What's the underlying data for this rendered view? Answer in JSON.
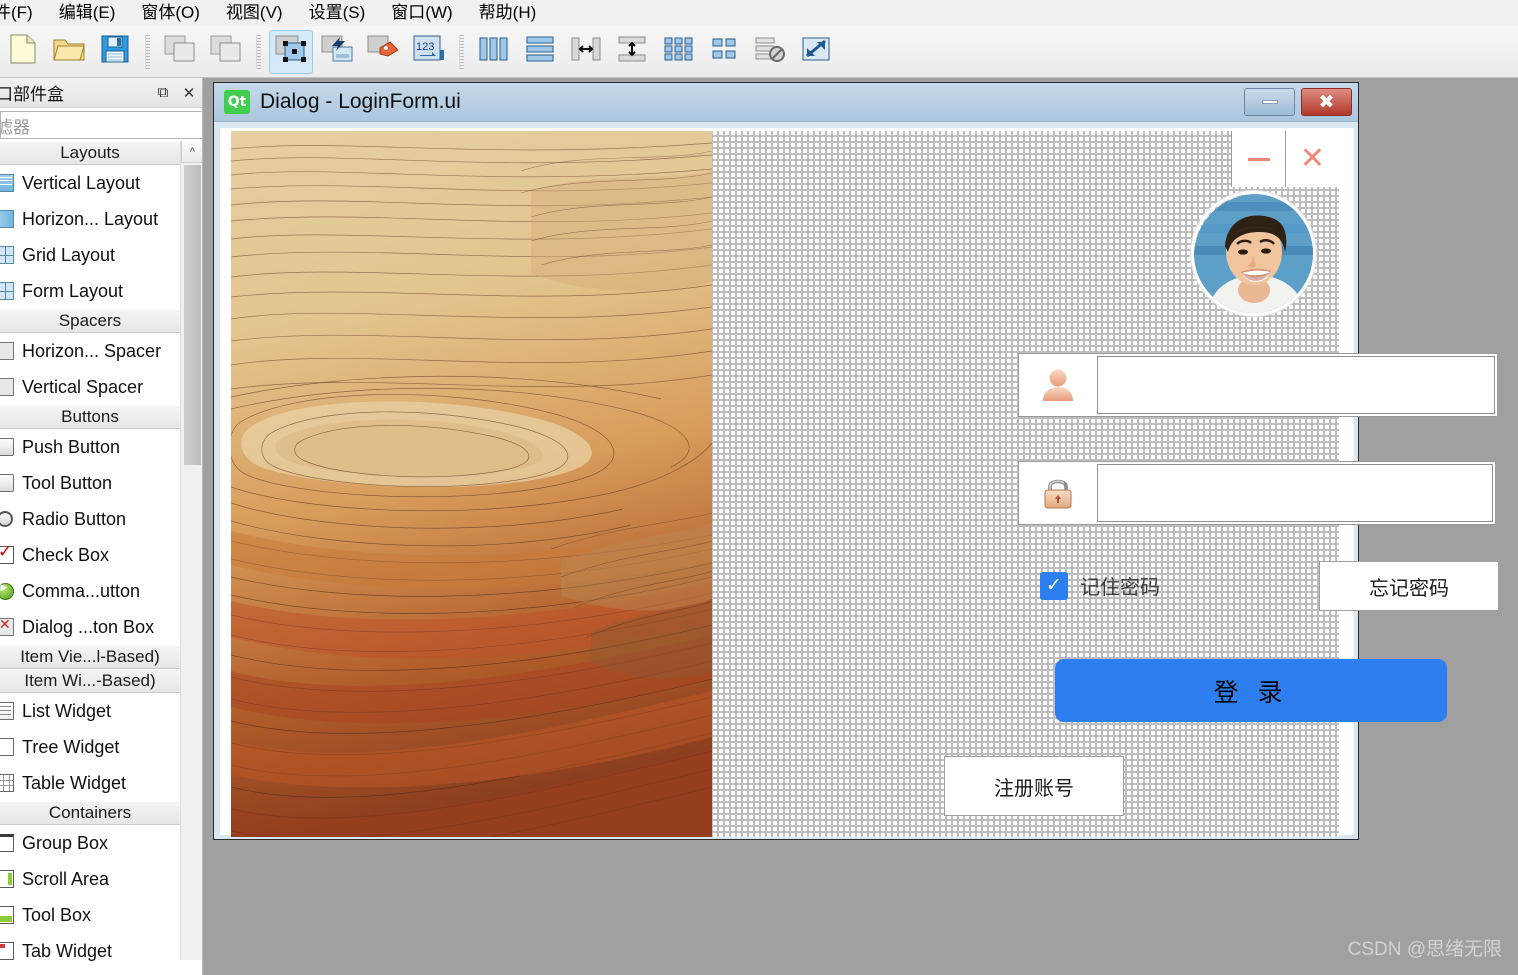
{
  "menubar": {
    "items": [
      {
        "label": "件(F)",
        "name": "menu-file"
      },
      {
        "label": "编辑(E)",
        "name": "menu-edit"
      },
      {
        "label": "窗体(O)",
        "name": "menu-form"
      },
      {
        "label": "视图(V)",
        "name": "menu-view"
      },
      {
        "label": "设置(S)",
        "name": "menu-settings"
      },
      {
        "label": "窗口(W)",
        "name": "menu-window"
      },
      {
        "label": "帮助(H)",
        "name": "menu-help"
      }
    ]
  },
  "toolbar": {
    "groups": [
      {
        "buttons": [
          {
            "icon": "new-file-icon",
            "active": false
          },
          {
            "icon": "open-folder-icon",
            "active": false
          },
          {
            "icon": "save-icon",
            "active": false
          }
        ]
      },
      {
        "buttons": [
          {
            "icon": "undo-icon",
            "active": false
          },
          {
            "icon": "redo-icon",
            "active": false
          }
        ]
      },
      {
        "buttons": [
          {
            "icon": "edit-widgets-icon",
            "active": true
          },
          {
            "icon": "edit-signals-slots-icon",
            "active": false
          },
          {
            "icon": "edit-buddies-icon",
            "active": false
          },
          {
            "icon": "edit-tab-order-icon",
            "active": false
          }
        ]
      },
      {
        "buttons": [
          {
            "icon": "layout-horizontal-icon",
            "active": false
          },
          {
            "icon": "layout-vertical-icon",
            "active": false
          },
          {
            "icon": "layout-splitter-h-icon",
            "active": false
          },
          {
            "icon": "layout-splitter-v-icon",
            "active": false
          },
          {
            "icon": "layout-grid-icon",
            "active": false
          },
          {
            "icon": "layout-form-icon",
            "active": false
          },
          {
            "icon": "break-layout-icon",
            "active": false
          },
          {
            "icon": "adjust-size-icon",
            "active": false
          }
        ]
      }
    ]
  },
  "widget_box": {
    "title": "口部件盒",
    "float_icon": "restore-icon",
    "close_icon": "close-icon",
    "filter_placeholder": "滤器",
    "scroll_up_icon": "chevron-up-icon",
    "groups": [
      {
        "category": "Layouts",
        "items": [
          {
            "label": "Vertical Layout",
            "icon": "vertical-layout-icon",
            "cls": "vl"
          },
          {
            "label": "Horizon... Layout",
            "icon": "horizontal-layout-icon",
            "cls": "hl"
          },
          {
            "label": "Grid Layout",
            "icon": "grid-layout-icon",
            "cls": "gl"
          },
          {
            "label": "Form Layout",
            "icon": "form-layout-icon",
            "cls": "gl"
          }
        ]
      },
      {
        "category": "Spacers",
        "items": [
          {
            "label": "Horizon... Spacer",
            "icon": "horizontal-spacer-icon",
            "cls": "sp"
          },
          {
            "label": "Vertical Spacer",
            "icon": "vertical-spacer-icon",
            "cls": "sp"
          }
        ]
      },
      {
        "category": "Buttons",
        "items": [
          {
            "label": "Push Button",
            "icon": "push-button-icon",
            "cls": "btn"
          },
          {
            "label": "Tool Button",
            "icon": "tool-button-icon",
            "cls": "btn"
          },
          {
            "label": "Radio Button",
            "icon": "radio-button-icon",
            "cls": "radio"
          },
          {
            "label": "Check Box",
            "icon": "check-box-icon",
            "cls": "check"
          },
          {
            "label": "Comma...utton",
            "icon": "command-link-button-icon",
            "cls": "green"
          },
          {
            "label": "Dialog ...ton Box",
            "icon": "dialog-button-box-icon",
            "cls": "redx"
          }
        ]
      },
      {
        "category": "Item Vie...l-Based)",
        "items": []
      },
      {
        "category": "Item Wi...-Based)",
        "items": [
          {
            "label": "List Widget",
            "icon": "list-widget-icon",
            "cls": "list"
          },
          {
            "label": "Tree Widget",
            "icon": "tree-widget-icon",
            "cls": "tree2"
          },
          {
            "label": "Table Widget",
            "icon": "table-widget-icon",
            "cls": "table2"
          }
        ]
      },
      {
        "category": "Containers",
        "items": [
          {
            "label": "Group Box",
            "icon": "group-box-icon",
            "cls": "gbox"
          },
          {
            "label": "Scroll Area",
            "icon": "scroll-area-icon",
            "cls": "scroll"
          },
          {
            "label": "Tool Box",
            "icon": "tool-box-icon",
            "cls": "toolbox"
          },
          {
            "label": "Tab Widget",
            "icon": "tab-widget-icon",
            "cls": "tabw"
          }
        ]
      }
    ]
  },
  "dialog_window": {
    "logo_text": "Qt",
    "title": "Dialog - LoginForm.ui",
    "minimize_icon": "minimize-icon",
    "close_icon": "close-icon"
  },
  "login_form": {
    "inner_minimize_icon": "minimize-icon",
    "inner_close_icon": "close-icon",
    "avatar_name": "user-avatar-photo",
    "username": {
      "icon": "user-icon",
      "value": "",
      "placeholder": ""
    },
    "password": {
      "icon": "lock-icon",
      "value": "",
      "placeholder": ""
    },
    "remember": {
      "label": "记住密码",
      "checked": true,
      "tick": "✓"
    },
    "forgot_label": "忘记密码",
    "login_label": "登 录",
    "register_label": "注册账号",
    "background_image": "wood-grain-contour-image"
  },
  "watermark": "CSDN @思绪无限",
  "colors": {
    "accent_blue": "#2d7ff0",
    "title_blue": "#abc6de",
    "qt_green": "#41cd52",
    "close_red": "#b13a2c",
    "inner_icon_salmon": "#f08878",
    "canvas_gray": "#a0a0a0"
  }
}
